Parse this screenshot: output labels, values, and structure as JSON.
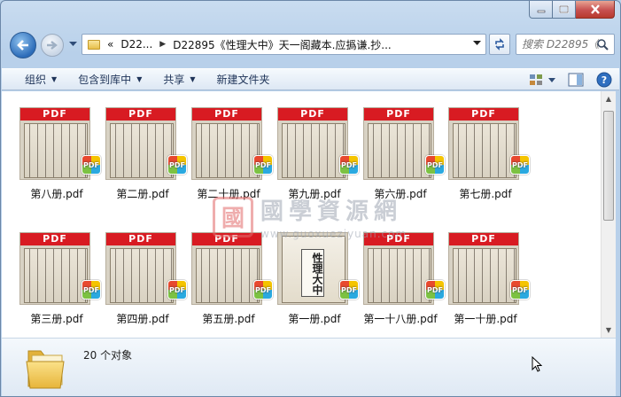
{
  "address": {
    "overflow": "«",
    "crumbs": [
      "D22...",
      "D22895《性理大中》天一阁藏本.应撝谦.抄..."
    ]
  },
  "search": {
    "placeholder": "搜索 D22895《..."
  },
  "toolbar": {
    "organize": "组织",
    "include_in_library": "包含到库中",
    "share": "共享",
    "new_folder": "新建文件夹"
  },
  "files": [
    {
      "name": "第八册.pdf",
      "band": "PDF",
      "cover": false
    },
    {
      "name": "第二册.pdf",
      "band": "PDF",
      "cover": false
    },
    {
      "name": "第二十册.pdf",
      "band": "PDF",
      "cover": false
    },
    {
      "name": "第九册.pdf",
      "band": "PDF",
      "cover": false
    },
    {
      "name": "第六册.pdf",
      "band": "PDF",
      "cover": false
    },
    {
      "name": "第七册.pdf",
      "band": "PDF",
      "cover": false
    },
    {
      "name": "第三册.pdf",
      "band": "PDF",
      "cover": false
    },
    {
      "name": "第四册.pdf",
      "band": "PDF",
      "cover": false
    },
    {
      "name": "第五册.pdf",
      "band": "PDF",
      "cover": false
    },
    {
      "name": "第一册.pdf",
      "band": "",
      "cover": true,
      "cover_title": "性理大中"
    },
    {
      "name": "第一十八册.pdf",
      "band": "PDF",
      "cover": false
    },
    {
      "name": "第一十册.pdf",
      "band": "PDF",
      "cover": false
    }
  ],
  "badge_text": "PDF",
  "watermark": {
    "seal": "國",
    "title": "國學資源網",
    "url": "www.guoxueziyuan.com"
  },
  "status": {
    "count_text": "20 个对象"
  },
  "colors": {
    "pdf_band": "#d81b22",
    "window_chrome": "#b9d1ea",
    "close_button": "#c75050"
  }
}
